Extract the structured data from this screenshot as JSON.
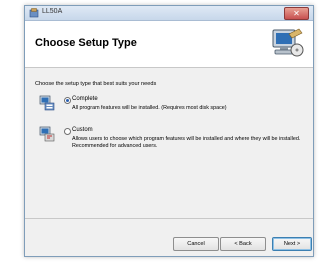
{
  "window": {
    "title": "LL50A"
  },
  "header": {
    "title": "Choose Setup Type"
  },
  "body": {
    "prompt": "Choose the setup type that best suits your needs",
    "options": [
      {
        "label": "Complete",
        "description": "All program features will be installed. (Requires most disk space)",
        "selected": true
      },
      {
        "label": "Custom",
        "description": "Allows users to choose which program features will be installed and where they will be installed. Recommended for advanced users.",
        "selected": false
      }
    ]
  },
  "buttons": {
    "cancel": "Cancel",
    "back": "< Back",
    "next": "Next >"
  }
}
